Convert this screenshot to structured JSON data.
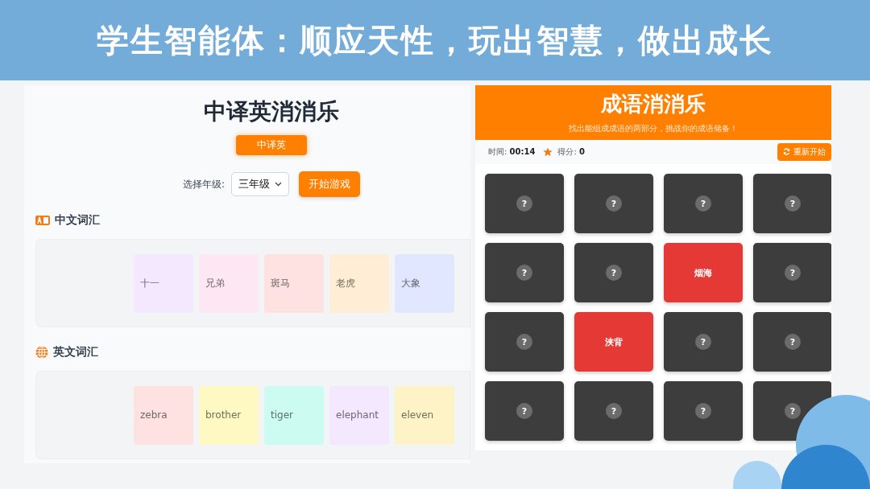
{
  "banner": {
    "title": "学生智能体：顺应天性，玩出智慧，做出成长"
  },
  "translate_game": {
    "title": "中译英消消乐",
    "mode_button": "中译英",
    "grade_label": "选择年级:",
    "grade_select": "三年级",
    "start_button": "开始游戏",
    "sections": [
      {
        "kind": "letters",
        "heading": "中文词汇",
        "tiles": [
          {
            "text": "十一",
            "color": "#f3e8ff"
          },
          {
            "text": "兄弟",
            "color": "#fce7f3"
          },
          {
            "text": "斑马",
            "color": "#fee2e2"
          },
          {
            "text": "老虎",
            "color": "#ffedd5"
          },
          {
            "text": "大象",
            "color": "#e0e7ff"
          }
        ]
      },
      {
        "kind": "globe",
        "heading": "英文词汇",
        "tiles": [
          {
            "text": "zebra",
            "color": "#fee2e2"
          },
          {
            "text": "brother",
            "color": "#fef9c3"
          },
          {
            "text": "tiger",
            "color": "#ccfbf1"
          },
          {
            "text": "elephant",
            "color": "#f3e8ff"
          },
          {
            "text": "eleven",
            "color": "#fef3c7"
          }
        ]
      }
    ]
  },
  "idiom_game": {
    "title": "成语消消乐",
    "subtitle": "找出能组成成语的两部分，挑战你的成语储备！",
    "time": "时间: **00:14**",
    "score": "得分: **0**",
    "restart_button": "重新开始",
    "cards": [
      {
        "flipped": false,
        "label": "?"
      },
      {
        "flipped": false,
        "label": "?"
      },
      {
        "flipped": false,
        "label": "?"
      },
      {
        "flipped": false,
        "label": "?"
      },
      {
        "flipped": false,
        "label": "?"
      },
      {
        "flipped": false,
        "label": "?"
      },
      {
        "flipped": true,
        "label": "烟海"
      },
      {
        "flipped": false,
        "label": "?"
      },
      {
        "flipped": false,
        "label": "?"
      },
      {
        "flipped": true,
        "label": "浃背"
      },
      {
        "flipped": false,
        "label": "?"
      },
      {
        "flipped": false,
        "label": "?"
      },
      {
        "flipped": false,
        "label": "?"
      },
      {
        "flipped": false,
        "label": "?"
      },
      {
        "flipped": false,
        "label": "?"
      },
      {
        "flipped": false,
        "label": "?"
      }
    ]
  }
}
